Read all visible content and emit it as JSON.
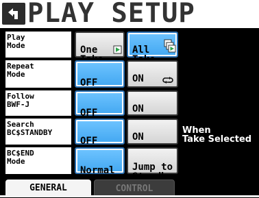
{
  "header": {
    "title": "PLAY SETUP"
  },
  "rows": [
    {
      "label": [
        "Play",
        "Mode"
      ],
      "options": [
        "One\nTake",
        "All\nTake"
      ],
      "selected": 1
    },
    {
      "label": [
        "Repeat",
        "Mode"
      ],
      "options": [
        "OFF",
        "ON"
      ],
      "selected": 0
    },
    {
      "label": [
        "Follow",
        "BWF-J"
      ],
      "options": [
        "OFF",
        "ON"
      ],
      "selected": 0
    },
    {
      "label": [
        "Search",
        "BC$STANDBY"
      ],
      "options": [
        "OFF",
        "ON"
      ],
      "selected": 0,
      "note": "When\nTake Selected"
    },
    {
      "label": [
        "BC$END",
        "Mode"
      ],
      "options": [
        "Normal",
        "Jump to\nStandby"
      ],
      "selected": 0
    }
  ],
  "tabs": [
    {
      "label": "GENERAL",
      "active": true
    },
    {
      "label": "CONTROL",
      "active": false
    }
  ],
  "colors": {
    "selected": "#42a7f1",
    "unselected": "#d8d8d8",
    "background": "#000000"
  }
}
